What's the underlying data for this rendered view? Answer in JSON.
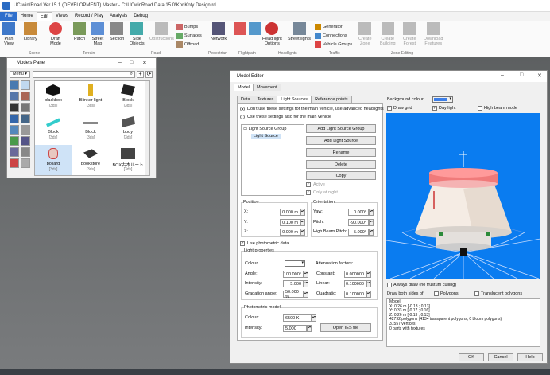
{
  "window": {
    "title": "UC-win/Road Ver.15.1 (DEVELOPMENT) Master - C:\\UCwinRoad Data 15.0\\KoriKoty Design.rd"
  },
  "menu": {
    "items": [
      "File",
      "Home",
      "Edit",
      "Views",
      "Record / Play",
      "Analysis",
      "Debug"
    ],
    "selected": "Edit"
  },
  "ribbon": {
    "buttons": {
      "plan_view": "Plan\nView",
      "library": "Library",
      "draft_mode": "Draft\nMode",
      "patch": "Patch",
      "street_map": "Street\nMap",
      "section": "Section",
      "side_objects": "Side\nObjects",
      "obstructions": "Obstructions",
      "network": "Network",
      "head_light": "Head light\nOptions",
      "street_lights": "Street lights",
      "create_zone": "Create\nZone",
      "create_building": "Create\nBuilding",
      "create_forest": "Create\nForest",
      "download_features": "Download\nFeatures"
    },
    "small": {
      "bumps": "Bumps",
      "surfaces": "Surfaces",
      "offroad": "Offroad",
      "generator": "Generator",
      "connections": "Connections",
      "vehicle_groups": "Vehicle Groups"
    },
    "groups": {
      "scene": "Scene",
      "terrain": "Terrain",
      "road": "Road",
      "pedestrian": "Pedestrian",
      "flightpath": "Flightpath",
      "headlights": "Headlights",
      "traffic": "Traffic",
      "zone_editing": "Zone Editing"
    }
  },
  "models_panel": {
    "title": "Models Panel",
    "menu_label": "Menu",
    "items": [
      {
        "name": "blackbox",
        "sub": "[3ds]"
      },
      {
        "name": "Blinker light",
        "sub": "[3ds]"
      },
      {
        "name": "Block",
        "sub": "[3ds]"
      },
      {
        "name": "Block",
        "sub": "[3ds]"
      },
      {
        "name": "Block",
        "sub": "[3ds]"
      },
      {
        "name": "body",
        "sub": "[3ds]"
      },
      {
        "name": "bollard",
        "sub": "[3ds]"
      },
      {
        "name": "bookstore",
        "sub": "[3ds]"
      },
      {
        "name": "BOX古本ルート",
        "sub": "[3ds]"
      }
    ]
  },
  "editor": {
    "title": "Model Editor",
    "outer_tabs": [
      "Model",
      "Movement"
    ],
    "inner_tabs": [
      "Data",
      "Textures",
      "Light Sources",
      "Reference points"
    ],
    "radio1": "Don't use these settings for the main vehicle, use advanced headlights",
    "radio2": "Use these settings also for the main vehicle",
    "tree": {
      "group": "Light Source Group",
      "child": "Light Source"
    },
    "buttons": {
      "add_group": "Add Light Source Group",
      "add_light": "Add Light Source",
      "rename": "Rename",
      "delete": "Delete",
      "copy": "Copy",
      "open_ies": "Open IES file",
      "ok": "OK",
      "cancel": "Cancel",
      "help": "Help"
    },
    "active": "Active",
    "only_at_night": "Only at night",
    "position": {
      "label": "Position",
      "x_label": "X:",
      "x": "0.000 m",
      "y_label": "Y:",
      "y": "0.100 m",
      "z_label": "Z:",
      "z": "0.000 m"
    },
    "orientation": {
      "label": "Orientation",
      "yaw_label": "Yaw:",
      "yaw": "0.000°",
      "pitch_label": "Pitch:",
      "pitch": "-90.000°",
      "hb_label": "High Beam Pitch:",
      "hb": "5.000°"
    },
    "use_photometric": "Use photometric data",
    "light_props": {
      "label": "Light properties",
      "colour_label": "Colour",
      "angle_label": "Angle:",
      "angle": "100.000°",
      "intensity_label": "Intensity:",
      "intensity": "5.000",
      "grad_label": "Gradation angle:",
      "grad": "50.000 %",
      "atten_label": "Attenuation factors:",
      "constant_label": "Constant:",
      "constant": "0.000000",
      "linear_label": "Linear:",
      "linear": "0.100000",
      "quadratic_label": "Quadratic:",
      "quadratic": "0.100000"
    },
    "photometric_model": {
      "label": "Photometric model",
      "colour_label": "Colour:",
      "colour": "6500 K",
      "intensity_label": "Intensity:",
      "intensity": "5.000"
    },
    "right": {
      "bg_label": "Background colour",
      "draw_grid": "Draw grid",
      "day_light": "Day light",
      "high_beam": "High beam mode",
      "always_draw": "Always draw (no frustum culling)",
      "draw_both": "Draw both sides of:",
      "polygons": "Polygons",
      "translucent": "Translucent polygons"
    },
    "info": [
      "Model",
      "X: 0.26 m [-0.13 ; 0.13]",
      "Y: 0.33 m [-0.17 ; 0.16]",
      "Z: 0.26 m [-0.13 ; 0.13]",
      "42792 polygons (4134 transparent polygons, 0 bloom polygons)",
      "31557 vertices",
      "0 parts with textures"
    ]
  },
  "colors": {
    "accent": "#2f6fcc",
    "viewport": "#0a7cf0",
    "bg_swatch": "#3c7ee8"
  }
}
